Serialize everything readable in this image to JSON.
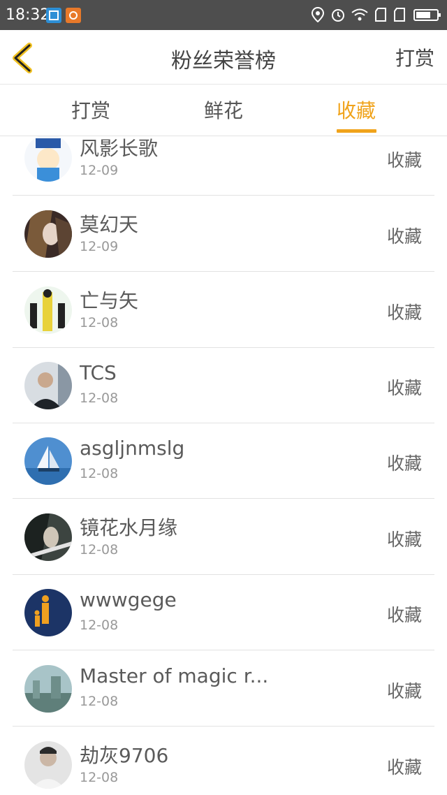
{
  "status_bar": {
    "time": "18:32",
    "icons": [
      "screenshot-notification-icon",
      "app-notification-icon",
      "location-icon",
      "alarm-icon",
      "wifi-icon",
      "sim1-signal-icon",
      "sim2-signal-icon",
      "battery-icon"
    ]
  },
  "header": {
    "title": "粉丝荣誉榜",
    "right_action": "打赏",
    "back_icon": "chevron-left-icon"
  },
  "tabs": [
    {
      "label": "打赏",
      "active": false
    },
    {
      "label": "鲜花",
      "active": false
    },
    {
      "label": "收藏",
      "active": true
    }
  ],
  "colors": {
    "accent": "#f0a31b",
    "status_bar": "#4e4e4e",
    "divider": "#e2e2e2"
  },
  "fans": [
    {
      "name": "风影长歌",
      "date": "12-09",
      "action": "收藏"
    },
    {
      "name": "莫幻天",
      "date": "12-09",
      "action": "收藏"
    },
    {
      "name": "亡与矢",
      "date": "12-08",
      "action": "收藏"
    },
    {
      "name": "TCS",
      "date": "12-08",
      "action": "收藏"
    },
    {
      "name": "asgljnmslg",
      "date": "12-08",
      "action": "收藏"
    },
    {
      "name": "镜花水月缘",
      "date": "12-08",
      "action": "收藏"
    },
    {
      "name": "wwwgege",
      "date": "12-08",
      "action": "收藏"
    },
    {
      "name": "Master of magic r...",
      "date": "12-08",
      "action": "收藏"
    },
    {
      "name": "劫灰9706",
      "date": "12-08",
      "action": "收藏"
    }
  ]
}
